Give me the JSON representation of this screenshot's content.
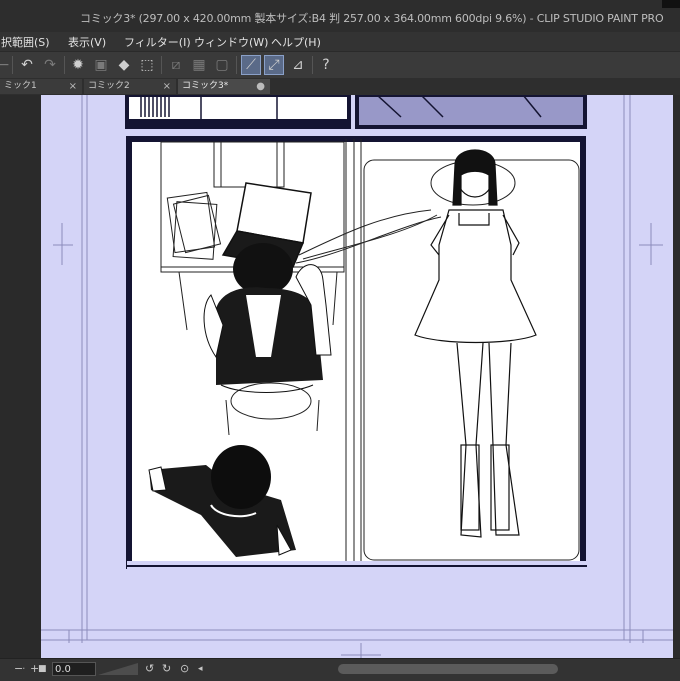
{
  "window": {
    "title": "コミック3* (297.00 x 420.00mm 製本サイズ:B4 判 257.00 x 364.00mm 600dpi 9.6%) - CLIP STUDIO PAINT PRO"
  },
  "menu": {
    "items": [
      "択範囲(S)",
      "表示(V)",
      "フィルター(I)",
      "ウィンドウ(W)",
      "ヘルプ(H)"
    ]
  },
  "toolbar": {
    "icons": [
      "undo-icon",
      "redo-icon",
      "loading-icon",
      "clear-icon",
      "fill-icon",
      "transform-icon",
      "ruler-snap-icon",
      "special-ruler-icon",
      "grid-snap-icon",
      "pen-stabilize-icon",
      "pen-stabilize-2-icon",
      "ruler-icon",
      "help-icon"
    ]
  },
  "tabs": [
    {
      "label": "ミック1",
      "active": false
    },
    {
      "label": "コミック2",
      "active": false
    },
    {
      "label": "コミック3*",
      "active": true
    }
  ],
  "status": {
    "zoom_value": "0.0",
    "minus": "−",
    "plus": "+"
  },
  "colors": {
    "paper": "#d4d4f7",
    "panel_border": "#141432",
    "ui_dark": "#2b2b2b"
  }
}
